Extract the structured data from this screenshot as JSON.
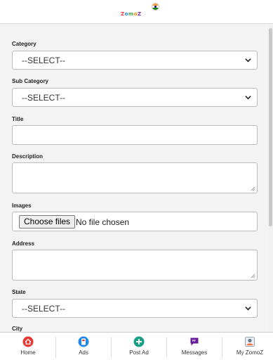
{
  "header": {
    "brand_word": "Zomoz"
  },
  "form": {
    "category_label": "Category",
    "category_value": "--SELECT--",
    "subcategory_label": "Sub Category",
    "subcategory_value": "--SELECT--",
    "title_label": "Title",
    "description_label": "Description",
    "images_label": "Images",
    "choose_files": "Choose files",
    "no_file": "No file chosen",
    "address_label": "Address",
    "state_label": "State",
    "state_value": "--SELECT--",
    "city_label": "City"
  },
  "nav": {
    "items": [
      {
        "label": "Home",
        "icon": "home-icon",
        "color": "#e53935"
      },
      {
        "label": "Ads",
        "icon": "ads-icon",
        "color": "#1e88e5"
      },
      {
        "label": "Post Ad",
        "icon": "plus-circle-icon",
        "color": "#16a085"
      },
      {
        "label": "Messages",
        "icon": "chat-icon",
        "color": "#6a1b9a"
      },
      {
        "label": "My ZomoZ",
        "icon": "user-icon",
        "color": "#607d8b"
      }
    ]
  }
}
